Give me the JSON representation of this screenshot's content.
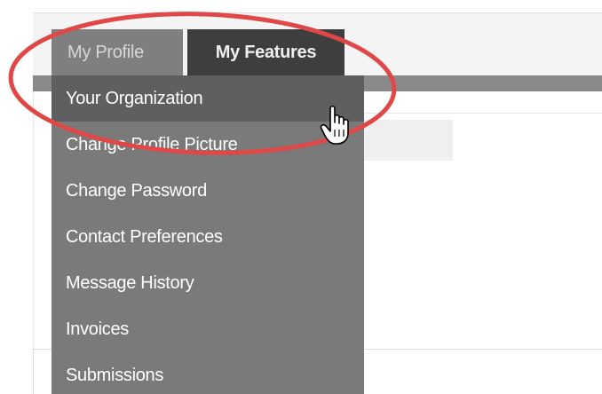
{
  "tabs": {
    "my_profile": "My Profile",
    "my_features": "My Features"
  },
  "menu": {
    "items": [
      {
        "label": "Your Organization"
      },
      {
        "label": "Change Profile Picture"
      },
      {
        "label": "Change Password"
      },
      {
        "label": "Contact Preferences"
      },
      {
        "label": "Message History"
      },
      {
        "label": "Invoices"
      },
      {
        "label": "Submissions"
      }
    ],
    "active_index": 0
  },
  "annotation": {
    "highlight_color": "#e04848"
  },
  "icons": {
    "cursor": "hand-pointer-icon"
  },
  "colors": {
    "tab_inactive": "#7f7f7f",
    "tab_active": "#3e3e3e",
    "menu_bg": "#7a7a7a",
    "menu_active_bg": "#5f5f5f"
  }
}
